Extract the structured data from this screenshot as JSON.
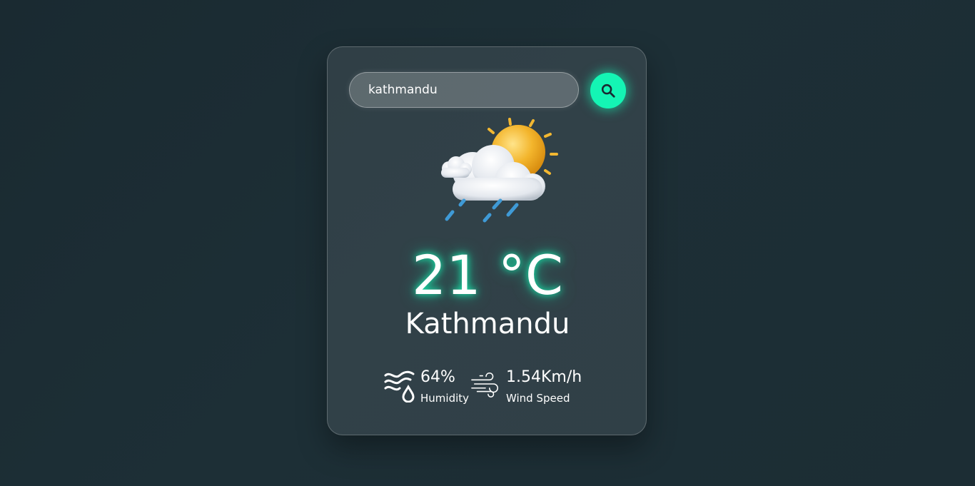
{
  "search": {
    "value": "kathmandu",
    "icon": "search-icon"
  },
  "weather": {
    "icon": "sun-cloud-rain-icon",
    "temperature": "21 °C",
    "city": "Kathmandu"
  },
  "humidity": {
    "value": "64%",
    "label": "Humidity",
    "icon": "humidity-icon"
  },
  "wind": {
    "value": "1.54Km/h",
    "label": "Wind Speed",
    "icon": "wind-icon"
  },
  "colors": {
    "accent": "#14f5b4",
    "background": "#1c2d34"
  }
}
